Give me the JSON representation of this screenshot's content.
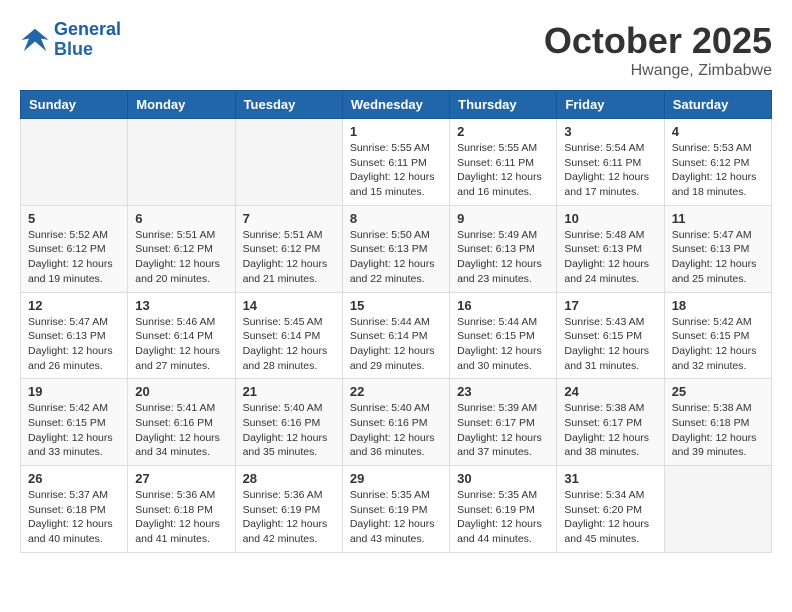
{
  "header": {
    "logo_line1": "General",
    "logo_line2": "Blue",
    "month": "October 2025",
    "location": "Hwange, Zimbabwe"
  },
  "weekdays": [
    "Sunday",
    "Monday",
    "Tuesday",
    "Wednesday",
    "Thursday",
    "Friday",
    "Saturday"
  ],
  "weeks": [
    [
      {
        "day": "",
        "info": ""
      },
      {
        "day": "",
        "info": ""
      },
      {
        "day": "",
        "info": ""
      },
      {
        "day": "1",
        "info": "Sunrise: 5:55 AM\nSunset: 6:11 PM\nDaylight: 12 hours\nand 15 minutes."
      },
      {
        "day": "2",
        "info": "Sunrise: 5:55 AM\nSunset: 6:11 PM\nDaylight: 12 hours\nand 16 minutes."
      },
      {
        "day": "3",
        "info": "Sunrise: 5:54 AM\nSunset: 6:11 PM\nDaylight: 12 hours\nand 17 minutes."
      },
      {
        "day": "4",
        "info": "Sunrise: 5:53 AM\nSunset: 6:12 PM\nDaylight: 12 hours\nand 18 minutes."
      }
    ],
    [
      {
        "day": "5",
        "info": "Sunrise: 5:52 AM\nSunset: 6:12 PM\nDaylight: 12 hours\nand 19 minutes."
      },
      {
        "day": "6",
        "info": "Sunrise: 5:51 AM\nSunset: 6:12 PM\nDaylight: 12 hours\nand 20 minutes."
      },
      {
        "day": "7",
        "info": "Sunrise: 5:51 AM\nSunset: 6:12 PM\nDaylight: 12 hours\nand 21 minutes."
      },
      {
        "day": "8",
        "info": "Sunrise: 5:50 AM\nSunset: 6:13 PM\nDaylight: 12 hours\nand 22 minutes."
      },
      {
        "day": "9",
        "info": "Sunrise: 5:49 AM\nSunset: 6:13 PM\nDaylight: 12 hours\nand 23 minutes."
      },
      {
        "day": "10",
        "info": "Sunrise: 5:48 AM\nSunset: 6:13 PM\nDaylight: 12 hours\nand 24 minutes."
      },
      {
        "day": "11",
        "info": "Sunrise: 5:47 AM\nSunset: 6:13 PM\nDaylight: 12 hours\nand 25 minutes."
      }
    ],
    [
      {
        "day": "12",
        "info": "Sunrise: 5:47 AM\nSunset: 6:13 PM\nDaylight: 12 hours\nand 26 minutes."
      },
      {
        "day": "13",
        "info": "Sunrise: 5:46 AM\nSunset: 6:14 PM\nDaylight: 12 hours\nand 27 minutes."
      },
      {
        "day": "14",
        "info": "Sunrise: 5:45 AM\nSunset: 6:14 PM\nDaylight: 12 hours\nand 28 minutes."
      },
      {
        "day": "15",
        "info": "Sunrise: 5:44 AM\nSunset: 6:14 PM\nDaylight: 12 hours\nand 29 minutes."
      },
      {
        "day": "16",
        "info": "Sunrise: 5:44 AM\nSunset: 6:15 PM\nDaylight: 12 hours\nand 30 minutes."
      },
      {
        "day": "17",
        "info": "Sunrise: 5:43 AM\nSunset: 6:15 PM\nDaylight: 12 hours\nand 31 minutes."
      },
      {
        "day": "18",
        "info": "Sunrise: 5:42 AM\nSunset: 6:15 PM\nDaylight: 12 hours\nand 32 minutes."
      }
    ],
    [
      {
        "day": "19",
        "info": "Sunrise: 5:42 AM\nSunset: 6:15 PM\nDaylight: 12 hours\nand 33 minutes."
      },
      {
        "day": "20",
        "info": "Sunrise: 5:41 AM\nSunset: 6:16 PM\nDaylight: 12 hours\nand 34 minutes."
      },
      {
        "day": "21",
        "info": "Sunrise: 5:40 AM\nSunset: 6:16 PM\nDaylight: 12 hours\nand 35 minutes."
      },
      {
        "day": "22",
        "info": "Sunrise: 5:40 AM\nSunset: 6:16 PM\nDaylight: 12 hours\nand 36 minutes."
      },
      {
        "day": "23",
        "info": "Sunrise: 5:39 AM\nSunset: 6:17 PM\nDaylight: 12 hours\nand 37 minutes."
      },
      {
        "day": "24",
        "info": "Sunrise: 5:38 AM\nSunset: 6:17 PM\nDaylight: 12 hours\nand 38 minutes."
      },
      {
        "day": "25",
        "info": "Sunrise: 5:38 AM\nSunset: 6:18 PM\nDaylight: 12 hours\nand 39 minutes."
      }
    ],
    [
      {
        "day": "26",
        "info": "Sunrise: 5:37 AM\nSunset: 6:18 PM\nDaylight: 12 hours\nand 40 minutes."
      },
      {
        "day": "27",
        "info": "Sunrise: 5:36 AM\nSunset: 6:18 PM\nDaylight: 12 hours\nand 41 minutes."
      },
      {
        "day": "28",
        "info": "Sunrise: 5:36 AM\nSunset: 6:19 PM\nDaylight: 12 hours\nand 42 minutes."
      },
      {
        "day": "29",
        "info": "Sunrise: 5:35 AM\nSunset: 6:19 PM\nDaylight: 12 hours\nand 43 minutes."
      },
      {
        "day": "30",
        "info": "Sunrise: 5:35 AM\nSunset: 6:19 PM\nDaylight: 12 hours\nand 44 minutes."
      },
      {
        "day": "31",
        "info": "Sunrise: 5:34 AM\nSunset: 6:20 PM\nDaylight: 12 hours\nand 45 minutes."
      },
      {
        "day": "",
        "info": ""
      }
    ]
  ]
}
